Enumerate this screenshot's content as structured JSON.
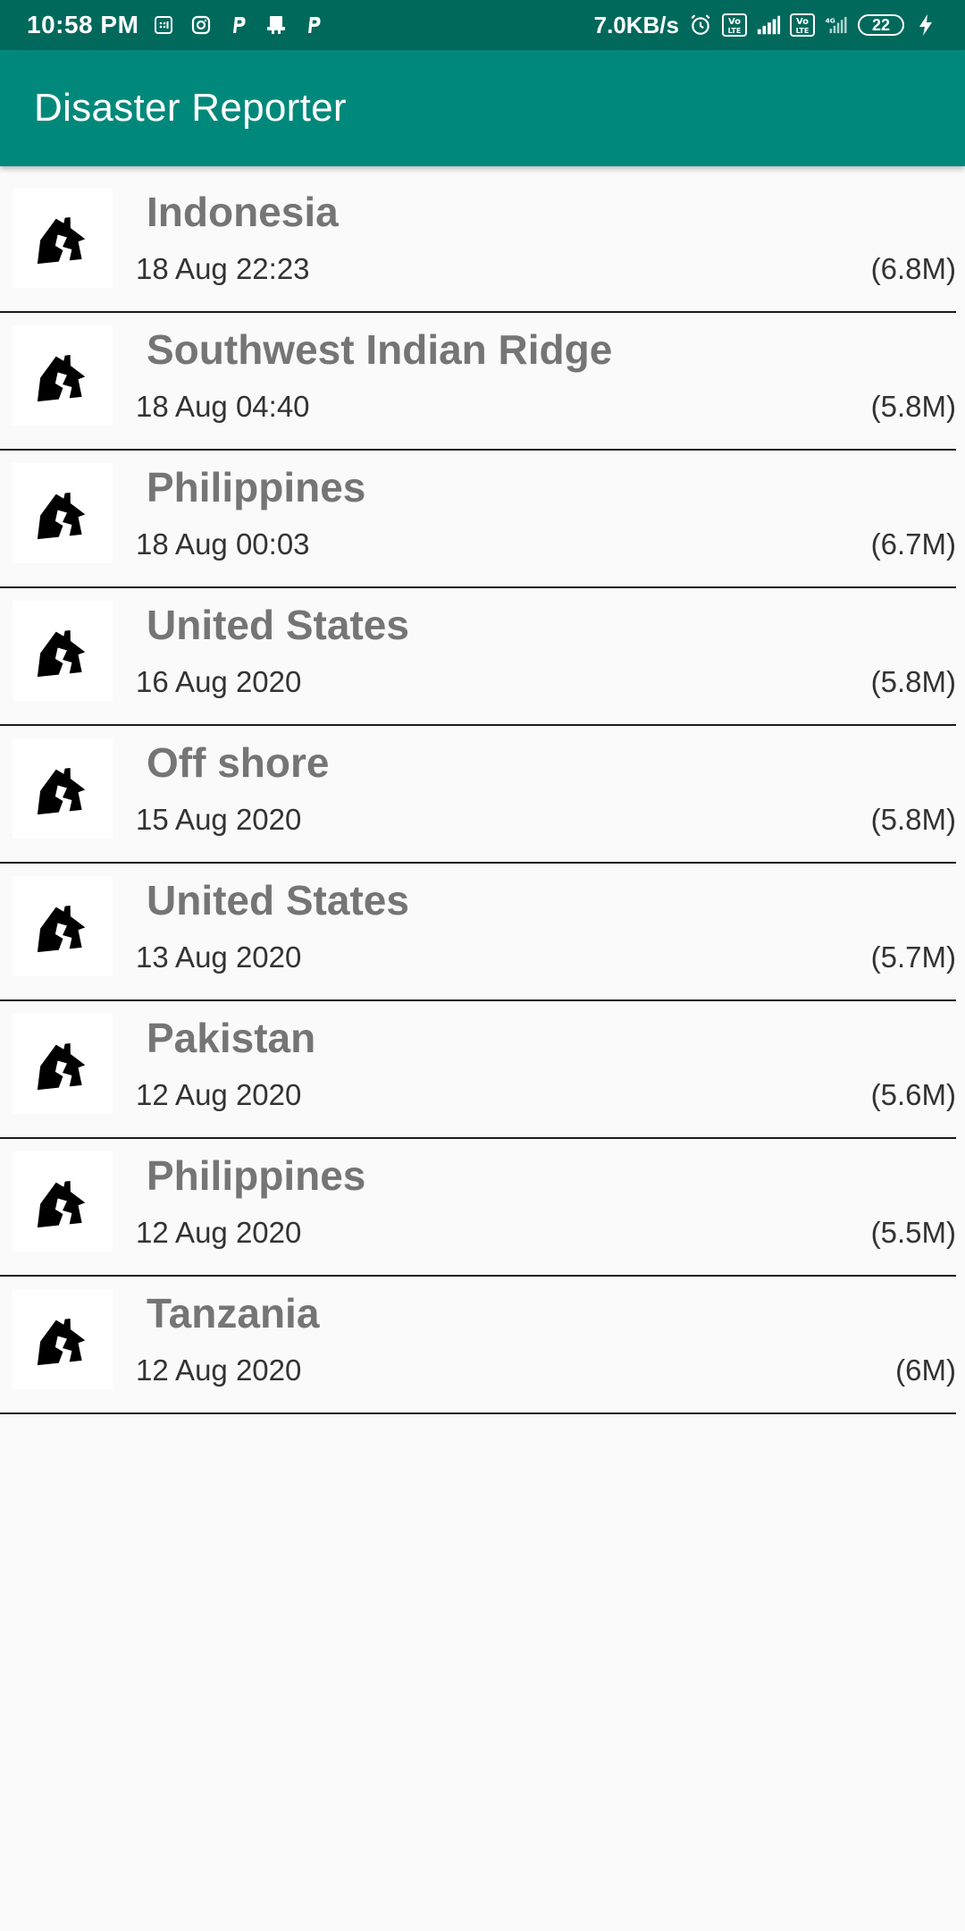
{
  "status_bar": {
    "time": "10:58 PM",
    "net_speed": "7.0KB/s",
    "battery": "22",
    "icons": [
      "sim-icon",
      "instagram-icon",
      "p-app-icon",
      "notification-icon",
      "p-app-icon",
      "alarm-icon",
      "volte-icon",
      "signal-icon",
      "volte-icon",
      "4g-signal-icon",
      "battery-icon",
      "charging-icon"
    ]
  },
  "app_bar": {
    "title": "Disaster Reporter"
  },
  "list": {
    "items": [
      {
        "title": "Indonesia",
        "date": "18 Aug 22:23",
        "magnitude": "(6.8M)",
        "icon": "earthquake-house-icon"
      },
      {
        "title": "Southwest Indian Ridge",
        "date": "18 Aug 04:40",
        "magnitude": "(5.8M)",
        "icon": "earthquake-house-icon"
      },
      {
        "title": "Philippines",
        "date": "18 Aug 00:03",
        "magnitude": "(6.7M)",
        "icon": "earthquake-house-icon"
      },
      {
        "title": "United States",
        "date": "16 Aug 2020",
        "magnitude": "(5.8M)",
        "icon": "earthquake-house-icon"
      },
      {
        "title": "Off shore",
        "date": "15 Aug 2020",
        "magnitude": "(5.8M)",
        "icon": "earthquake-house-icon"
      },
      {
        "title": "United States",
        "date": "13 Aug 2020",
        "magnitude": "(5.7M)",
        "icon": "earthquake-house-icon"
      },
      {
        "title": "Pakistan",
        "date": "12 Aug 2020",
        "magnitude": "(5.6M)",
        "icon": "earthquake-house-icon"
      },
      {
        "title": "Philippines",
        "date": "12 Aug 2020",
        "magnitude": "(5.5M)",
        "icon": "earthquake-house-icon"
      },
      {
        "title": "Tanzania",
        "date": "12 Aug 2020",
        "magnitude": "(6M)",
        "icon": "earthquake-house-icon"
      }
    ]
  },
  "colors": {
    "status_bar": "#00695c",
    "app_bar": "#00897b",
    "title_text": "#757575",
    "background": "#fafafa"
  }
}
